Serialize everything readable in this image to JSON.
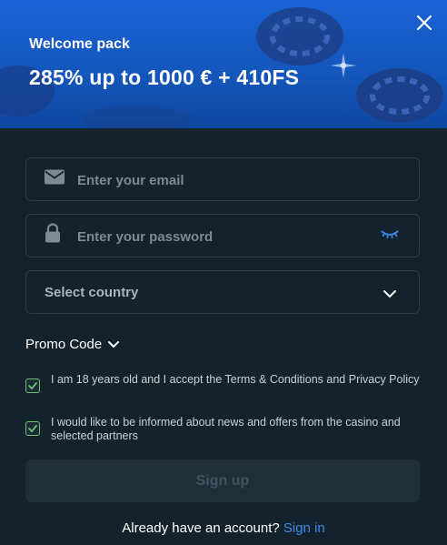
{
  "banner": {
    "subtitle": "Welcome pack",
    "title": "285% up to 1000 € + 410FS"
  },
  "form": {
    "email_placeholder": "Enter your email",
    "password_placeholder": "Enter your password",
    "country_label": "Select country",
    "promo_label": "Promo Code"
  },
  "consents": [
    {
      "text": "I am 18 years old and I accept the Terms & Conditions and Privacy Policy",
      "checked": true
    },
    {
      "text": "I would like to be informed about news and offers from the casino and selected partners",
      "checked": true
    }
  ],
  "signup_label": "Sign up",
  "footer": {
    "prompt": "Already have an account?",
    "link": "Sign in"
  },
  "colors": {
    "banner": "#1a62d6",
    "background": "#13222c",
    "accent": "#3d8ae8",
    "check": "#6fbf73"
  },
  "icons": [
    "close-icon",
    "mail-icon",
    "lock-icon",
    "eye-closed-icon",
    "chevron-down-icon"
  ]
}
